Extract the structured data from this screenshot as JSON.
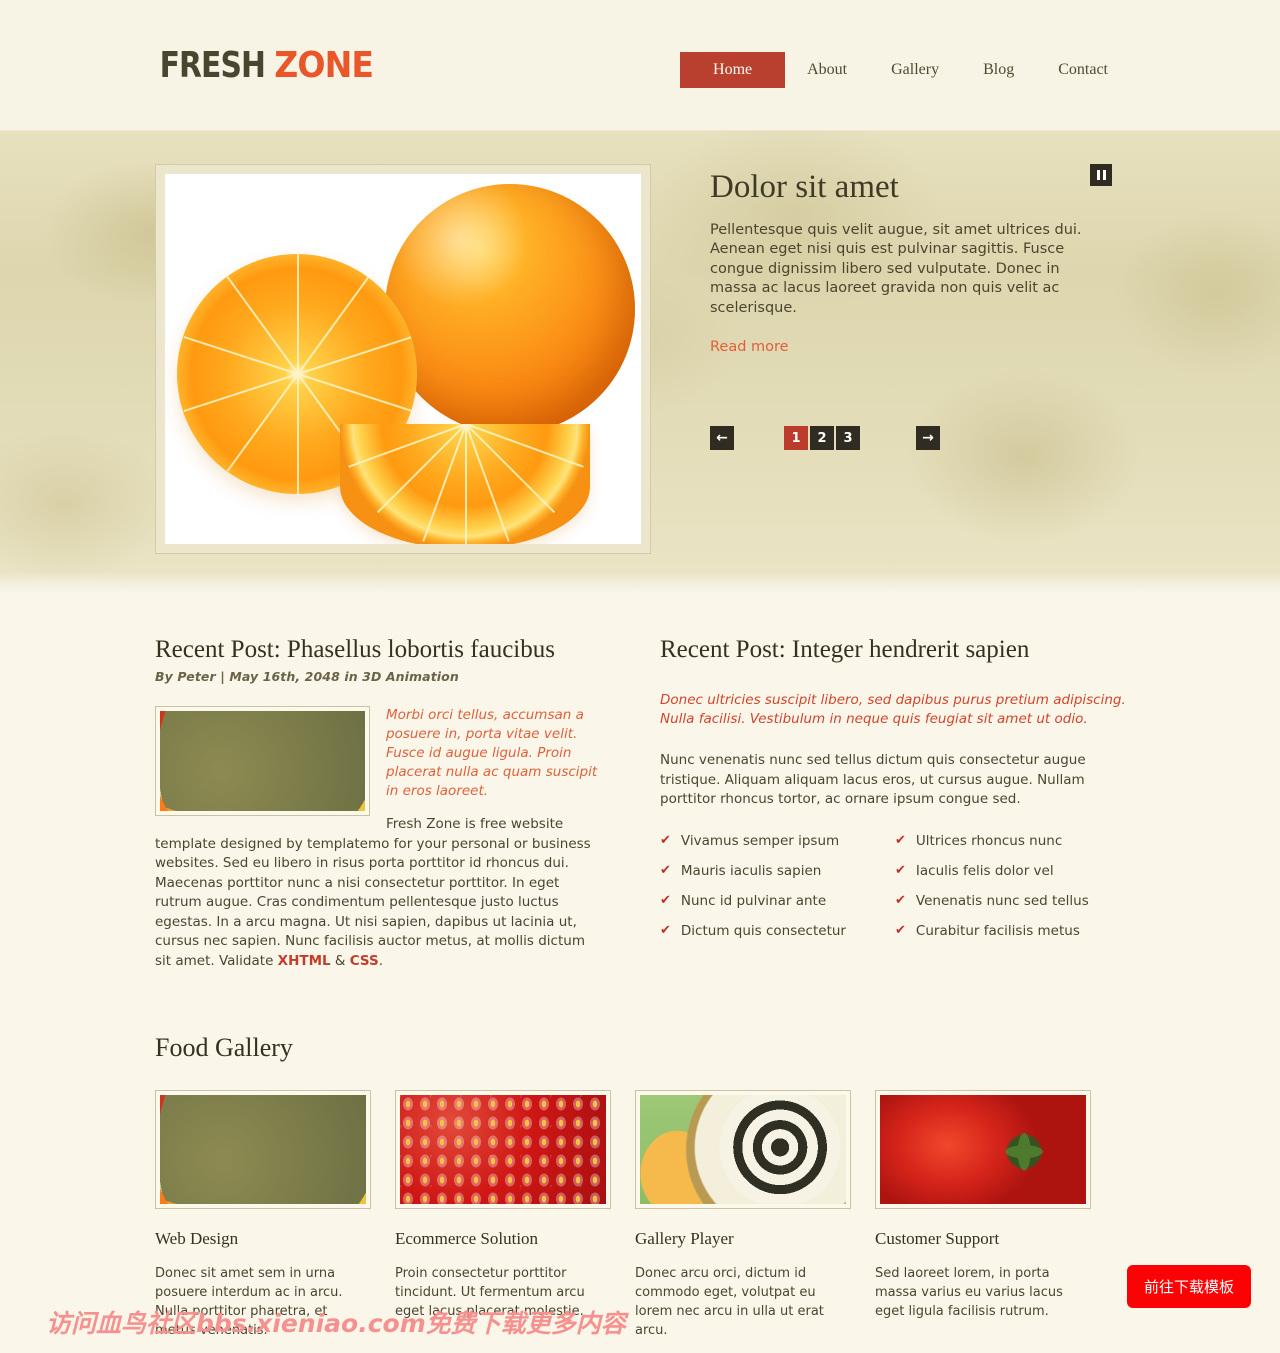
{
  "site": {
    "logo_primary": "FRESH",
    "logo_accent": "ZONE"
  },
  "nav": {
    "items": [
      {
        "label": "Home",
        "active": true
      },
      {
        "label": "About",
        "active": false
      },
      {
        "label": "Gallery",
        "active": false
      },
      {
        "label": "Blog",
        "active": false
      },
      {
        "label": "Contact",
        "active": false
      }
    ]
  },
  "slider": {
    "title": "Dolor sit amet",
    "description": "Pellentesque quis velit augue, sit amet ultrices dui. Aenean eget nisi quis est pulvinar sagittis. Fusce congue dignissim libero sed vulputate. Donec in massa ac lacus laoreet gravida non quis velit ac scelerisque.",
    "read_more": "Read more",
    "pause_icon": "pause-icon",
    "prev_icon": "←",
    "next_icon": "→",
    "pages": [
      "1",
      "2",
      "3"
    ],
    "active_page": "1",
    "image_alt": "oranges-photo"
  },
  "post_left": {
    "title": "Recent Post: Phasellus lobortis faucibus",
    "meta": "By Peter | May 16th, 2048 in 3D Animation",
    "thumb_alt": "chili-peppers-thumbnail",
    "intro": "Morbi orci tellus, accumsan a posuere in, porta vitae velit. Fusce id augue ligula. Proin placerat nulla ac quam suscipit in eros laoreet.",
    "body_before": "Fresh Zone is free website template designed by templatemo for your personal or business websites. Sed eu libero in risus porta porttitor id rhoncus dui. Maecenas porttitor nunc a nisi consectetur porttitor. In eget rutrum augue. Cras condimentum pellentesque justo luctus egestas. In a arcu magna. Ut nisi sapien, dapibus ut lacinia ut, cursus nec sapien. Nunc facilisis auctor metus, at mollis dictum sit amet. Validate ",
    "link_xhtml": "XHTML",
    "body_amp": " & ",
    "link_css": "CSS",
    "body_end": "."
  },
  "post_right": {
    "title": "Recent Post: Integer hendrerit sapien",
    "intro": "Donec ultricies suscipit libero, sed dapibus purus pretium adipiscing. Nulla facilisi. Vestibulum in neque quis feugiat sit amet ut odio.",
    "body": "Nunc venenatis nunc sed tellus dictum quis consectetur augue tristique. Aliquam aliquam lacus eros, ut cursus augue. Nullam porttitor rhoncus tortor, ac ornare ipsum congue sed.",
    "check_icon": "✔",
    "checklist_left": [
      "Vivamus semper ipsum",
      "Mauris iaculis sapien",
      "Nunc id pulvinar ante",
      "Dictum quis consectetur"
    ],
    "checklist_right": [
      "Ultrices rhoncus nunc",
      "Iaculis felis dolor vel",
      "Venenatis nunc sed tellus",
      "Curabitur facilisis metus"
    ]
  },
  "gallery": {
    "title": "Food Gallery",
    "items": [
      {
        "image_alt": "chili-peppers-image",
        "title": "Web Design",
        "text": "Donec sit amet sem in urna posuere interdum ac in arcu. Nulla porttitor pharetra, et metus venenatis."
      },
      {
        "image_alt": "strawberry-image",
        "title": "Ecommerce Solution",
        "text": "Proin consectetur porttitor tincidunt. Ut fermentum arcu eget lacus placerat molestie."
      },
      {
        "image_alt": "coffee-cup-image",
        "title": "Gallery Player",
        "text": "Donec arcu orci, dictum id commodo eget, volutpat eu lorem nec arcu in ulla ut erat arcu."
      },
      {
        "image_alt": "tomatoes-image",
        "title": "Customer Support",
        "text": "Sed laoreet lorem, in porta massa varius eu varius lacus eget ligula facilisis rutrum."
      }
    ]
  },
  "overlay": {
    "watermark": "访问血鸟社区bbs.xieniao.com免费下载更多内容",
    "download_button": "前往下载模板"
  },
  "colors": {
    "accent_red": "#b9402f",
    "accent_orange": "#e8562a",
    "link_red": "#c53c28",
    "page_bg": "#faf7ea",
    "dark_text": "#35311f",
    "download_red": "#fb0304",
    "watermark_pink": "#f6918f"
  }
}
